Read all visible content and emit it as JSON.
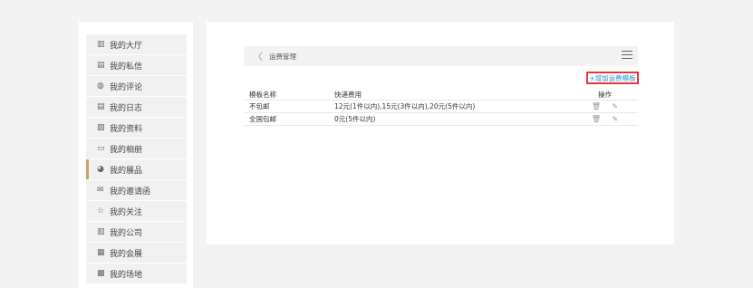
{
  "sidebar": {
    "items": [
      {
        "icon": "building-icon",
        "glyph": "▥",
        "label": "我的大厅"
      },
      {
        "icon": "message-icon",
        "glyph": "▤",
        "label": "我的私信"
      },
      {
        "icon": "comment-icon",
        "glyph": "◍",
        "label": "我的评论"
      },
      {
        "icon": "journal-icon",
        "glyph": "▤",
        "label": "我的日志"
      },
      {
        "icon": "profile-icon",
        "glyph": "▨",
        "label": "我的资料"
      },
      {
        "icon": "album-icon",
        "glyph": "▭",
        "label": "我的相册"
      },
      {
        "icon": "showcase-icon",
        "glyph": "◕",
        "label": "我的展品",
        "active": true
      },
      {
        "icon": "envelope-icon",
        "glyph": "✉",
        "label": "我的邀请函"
      },
      {
        "icon": "star-icon",
        "glyph": "☆",
        "label": "我的关注"
      },
      {
        "icon": "company-icon",
        "glyph": "▥",
        "label": "我的公司"
      },
      {
        "icon": "exhibition-icon",
        "glyph": "▦",
        "label": "我的会展"
      },
      {
        "icon": "venue-icon",
        "glyph": "▩",
        "label": "我的场地"
      }
    ]
  },
  "header": {
    "title": "运费管理",
    "back_glyph": "〈"
  },
  "add_button": "+增加运费模板",
  "table": {
    "columns": [
      "模板名称",
      "快递费用",
      "操作"
    ],
    "rows": [
      {
        "name": "不包邮",
        "fee": "12元(1件以内),15元(3件以内),20元(5件以内)"
      },
      {
        "name": "全国包邮",
        "fee": "0元(5件以内)"
      }
    ],
    "delete_glyph": "🗑",
    "edit_glyph": "✎"
  },
  "colors": {
    "accent": "#c8a46e",
    "link": "#2a8bd2",
    "highlight_border": "#e33333"
  }
}
